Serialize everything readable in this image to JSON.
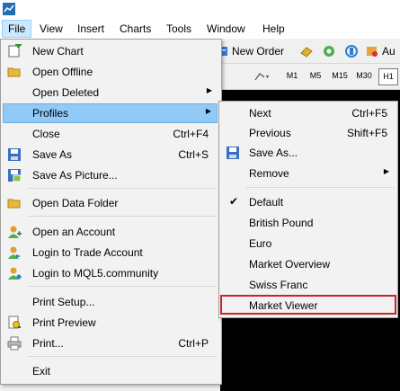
{
  "menubar": {
    "items": [
      {
        "label": "File"
      },
      {
        "label": "View"
      },
      {
        "label": "Insert"
      },
      {
        "label": "Charts"
      },
      {
        "label": "Tools"
      },
      {
        "label": "Window"
      },
      {
        "label": "Help"
      }
    ]
  },
  "toolbar": {
    "new_order_label": "New Order",
    "auto_label": "Au",
    "timeframes": [
      "M1",
      "M5",
      "M15",
      "M30",
      "H1"
    ],
    "selected_timeframe": "H1"
  },
  "file_menu": {
    "new_chart": "New Chart",
    "open_offline": "Open Offline",
    "open_deleted": "Open Deleted",
    "profiles": "Profiles",
    "close": "Close",
    "close_shortcut": "Ctrl+F4",
    "save_as": "Save As",
    "save_as_shortcut": "Ctrl+S",
    "save_as_picture": "Save As Picture...",
    "open_data_folder": "Open Data Folder",
    "open_account": "Open an Account",
    "login_trade": "Login to Trade Account",
    "login_mql5": "Login to MQL5.community",
    "print_setup": "Print Setup...",
    "print_preview": "Print Preview",
    "print": "Print...",
    "print_shortcut": "Ctrl+P",
    "exit": "Exit"
  },
  "profiles_menu": {
    "next": "Next",
    "next_shortcut": "Ctrl+F5",
    "previous": "Previous",
    "previous_shortcut": "Shift+F5",
    "save_as": "Save As...",
    "remove": "Remove",
    "profiles": [
      "Default",
      "British Pound",
      "Euro",
      "Market Overview",
      "Swiss Franc",
      "Market Viewer"
    ],
    "checked": "Default"
  },
  "colors": {
    "highlight": "#91c9f7",
    "menu_bg": "#f2f2f2",
    "box_outline": "#c4262e"
  }
}
